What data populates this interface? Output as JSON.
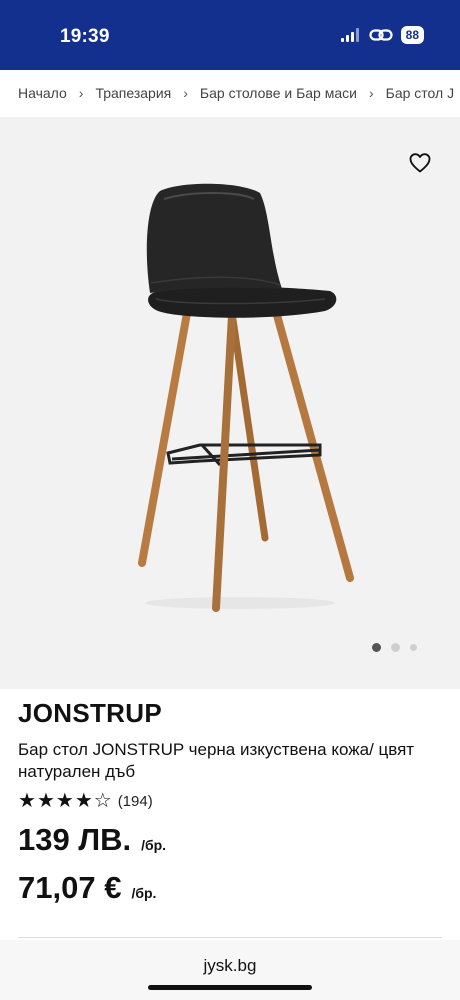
{
  "status_bar": {
    "time": "19:39",
    "battery": "88",
    "icons": [
      "signal-icon",
      "link-icon",
      "battery-icon"
    ]
  },
  "breadcrumb": {
    "items": [
      "Начало",
      "Трапезария",
      "Бар столове и Бар маси",
      "Бар стол J"
    ]
  },
  "product": {
    "image_dots": {
      "count": 3,
      "active_index": 0
    },
    "name": "JONSTRUP",
    "description": "Бар стол JONSTRUP черна изкуствена кожа/ цвят натурален дъб",
    "rating": {
      "filled_stars": 4,
      "total_stars": 5,
      "review_count": "(194)"
    },
    "price_bgn": "139 ЛВ.",
    "price_bgn_unit": "/бр.",
    "price_eur": "71,07 €",
    "price_eur_unit": "/бр."
  },
  "browser": {
    "url": "jysk.bg"
  },
  "colors": {
    "brand_blue": "#14308f",
    "image_bg": "#f2f2f2",
    "wood": "#b5783f",
    "leather": "#222222"
  }
}
